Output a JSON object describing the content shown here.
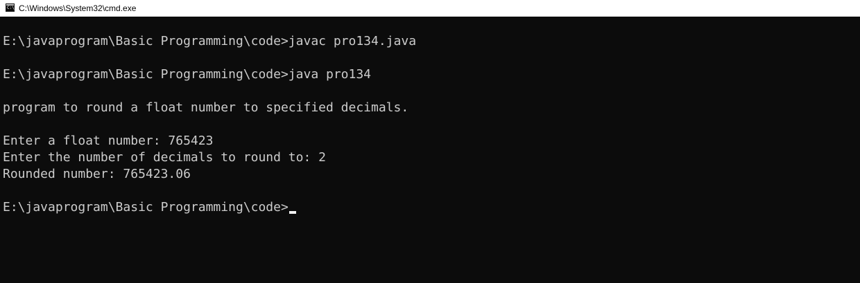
{
  "window": {
    "title": "C:\\Windows\\System32\\cmd.exe",
    "icon": "cmd-console-icon"
  },
  "console": {
    "lines": [
      "E:\\javaprogram\\Basic Programming\\code>javac pro134.java",
      "E:\\javaprogram\\Basic Programming\\code>java pro134",
      "program to round a float number to specified decimals.",
      "Enter a float number: 765423",
      "Enter the number of decimals to round to: 2",
      "Rounded number: 765423.06",
      "E:\\javaprogram\\Basic Programming\\code>"
    ]
  },
  "colors": {
    "background": "#0c0c0c",
    "text": "#cccccc",
    "titlebar": "#ffffff",
    "cursor": "#f2f2f2"
  }
}
